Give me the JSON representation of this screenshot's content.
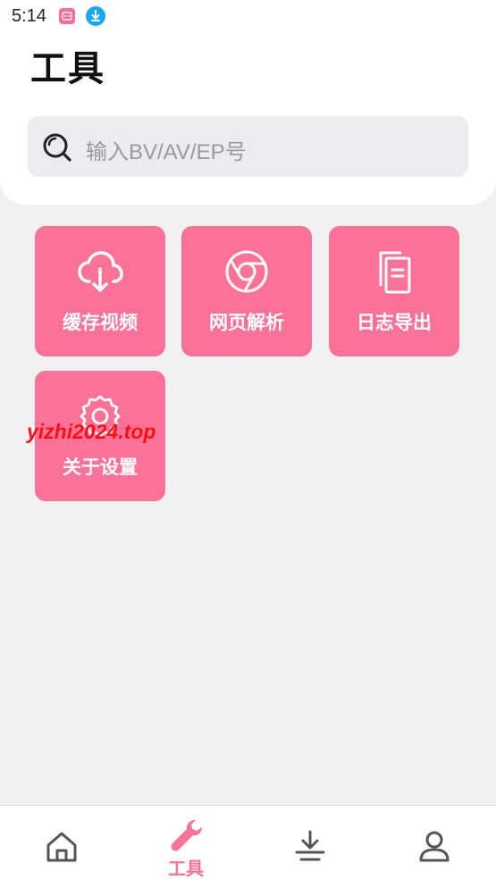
{
  "status_bar": {
    "time": "5:14",
    "icons": [
      "app-notification-icon",
      "download-notification-icon"
    ]
  },
  "header": {
    "title": "工具"
  },
  "search": {
    "placeholder": "输入BV/AV/EP号",
    "icon": "search-icon"
  },
  "tools": [
    {
      "label": "缓存视频",
      "icon": "cloud-download-icon"
    },
    {
      "label": "网页解析",
      "icon": "browser-icon"
    },
    {
      "label": "日志导出",
      "icon": "document-copy-icon"
    },
    {
      "label": "关于设置",
      "icon": "gear-icon"
    }
  ],
  "watermark": "yizhi2024.top",
  "bottom_nav": {
    "items": [
      {
        "icon": "home-icon",
        "label": ""
      },
      {
        "icon": "wrench-icon",
        "label": "工具",
        "active": true
      },
      {
        "icon": "download-tray-icon",
        "label": ""
      },
      {
        "icon": "profile-icon",
        "label": ""
      }
    ]
  },
  "colors": {
    "accent": "#fb7299",
    "background": "#f1f1f2",
    "search_bg": "#ececef",
    "watermark": "#ff1010",
    "nav_inactive": "#555555"
  }
}
